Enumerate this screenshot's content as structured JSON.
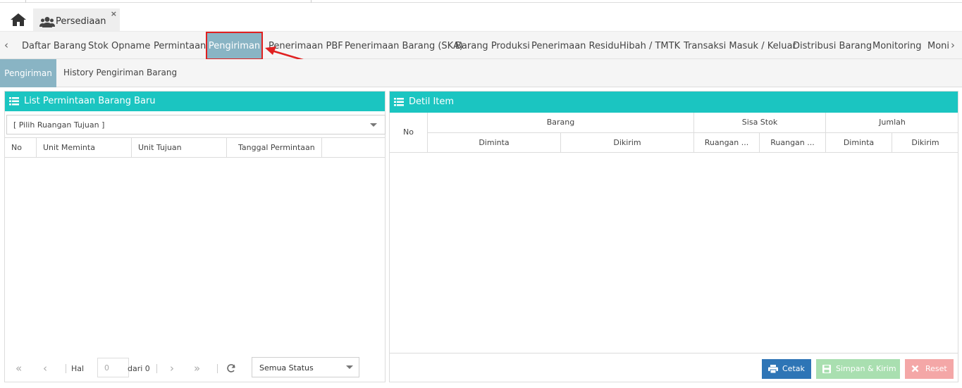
{
  "top_tab": {
    "label": "Persediaan",
    "close": "×"
  },
  "menu": {
    "items": [
      "Daftar Barang",
      "Stok Opname",
      "Permintaan",
      "Pengiriman",
      "Penerimaan PBF",
      "Penerimaan Barang (SKA)",
      "Barang Produksi",
      "Penerimaan Residu",
      "Hibah / TMTK",
      "Transaksi Masuk / Keluar",
      "Distribusi Barang",
      "Monitoring",
      "Moni"
    ],
    "active": "Pengiriman"
  },
  "submenu": {
    "active": "Pengiriman",
    "other": "History Pengiriman Barang"
  },
  "left_panel": {
    "title": "List Permintaan Barang Baru",
    "combo_value": "[ Pilih Ruangan Tujuan ]",
    "columns": [
      "No",
      "Unit Meminta",
      "Unit Tujuan",
      "Tanggal Permintaan"
    ],
    "pager": {
      "page_label": "Hal",
      "page_value": "0",
      "of_label": "dari 0",
      "status_value": "Semua Status"
    }
  },
  "right_panel": {
    "title": "Detil Item",
    "col_no": "No",
    "group_barang": "Barang",
    "group_sisa_stok": "Sisa Stok",
    "group_jumlah": "Jumlah",
    "sub_diminta": "Diminta",
    "sub_dikirim": "Dikirim",
    "sub_ruangan_1": "Ruangan ...",
    "sub_ruangan_2": "Ruangan ...",
    "sub_jumlah_diminta": "Diminta",
    "sub_jumlah_dikirim": "Dikirim",
    "buttons": {
      "print": "Cetak",
      "save": "Simpan & Kirim",
      "reset": "Reset"
    }
  },
  "colors": {
    "header_teal": "#1bc5c1",
    "active_tab": "#89b4c4",
    "highlight_red": "#e02020",
    "print_btn": "#2e75b6",
    "save_btn": "#a9dfb0",
    "reset_btn": "#f4a7a7"
  }
}
